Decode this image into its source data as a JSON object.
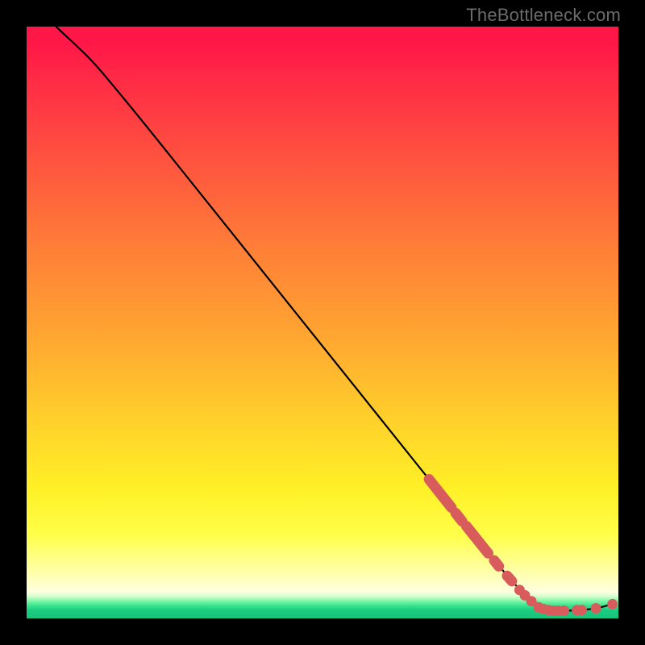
{
  "watermark": "TheBottleneck.com",
  "chart_data": {
    "type": "line",
    "title": "",
    "xlabel": "",
    "ylabel": "",
    "xlim": [
      0,
      100
    ],
    "ylim": [
      0,
      100
    ],
    "grid": false,
    "curve": {
      "name": "bottleneck-curve",
      "color": "#000000",
      "points": [
        {
          "x": 5.0,
          "y": 100.0
        },
        {
          "x": 6.0,
          "y": 99.0
        },
        {
          "x": 8.0,
          "y": 97.2
        },
        {
          "x": 11.0,
          "y": 94.3
        },
        {
          "x": 14.0,
          "y": 90.8
        },
        {
          "x": 20.0,
          "y": 83.5
        },
        {
          "x": 30.0,
          "y": 71.0
        },
        {
          "x": 40.0,
          "y": 58.5
        },
        {
          "x": 50.0,
          "y": 46.0
        },
        {
          "x": 60.0,
          "y": 33.5
        },
        {
          "x": 70.0,
          "y": 21.0
        },
        {
          "x": 78.0,
          "y": 11.0
        },
        {
          "x": 84.0,
          "y": 4.0
        },
        {
          "x": 87.0,
          "y": 1.6
        },
        {
          "x": 89.0,
          "y": 1.3
        },
        {
          "x": 92.0,
          "y": 1.3
        },
        {
          "x": 96.0,
          "y": 1.6
        },
        {
          "x": 99.0,
          "y": 2.4
        }
      ]
    },
    "highlight_segments": {
      "name": "data-density-markers",
      "color": "#d95c5c",
      "segments": [
        {
          "x0": 68.0,
          "y0": 23.5,
          "x1": 71.8,
          "y1": 18.7
        },
        {
          "x0": 72.5,
          "y0": 17.8,
          "x1": 73.6,
          "y1": 16.4
        },
        {
          "x0": 74.3,
          "y0": 15.6,
          "x1": 78.0,
          "y1": 11.0
        },
        {
          "x0": 79.0,
          "y0": 9.8,
          "x1": 79.8,
          "y1": 8.8
        },
        {
          "x0": 81.2,
          "y0": 7.2,
          "x1": 82.0,
          "y1": 6.3
        }
      ]
    },
    "highlight_dots": {
      "name": "data-points",
      "color": "#d95c5c",
      "points": [
        {
          "x": 83.3,
          "y": 4.8
        },
        {
          "x": 84.2,
          "y": 3.9
        },
        {
          "x": 85.3,
          "y": 2.9
        },
        {
          "x": 86.5,
          "y": 1.9
        },
        {
          "x": 87.3,
          "y": 1.6
        },
        {
          "x": 88.2,
          "y": 1.4
        },
        {
          "x": 89.0,
          "y": 1.3
        },
        {
          "x": 89.8,
          "y": 1.3
        },
        {
          "x": 90.8,
          "y": 1.3
        },
        {
          "x": 93.0,
          "y": 1.4
        },
        {
          "x": 93.8,
          "y": 1.4
        },
        {
          "x": 96.2,
          "y": 1.7
        },
        {
          "x": 99.0,
          "y": 2.4
        }
      ]
    }
  }
}
